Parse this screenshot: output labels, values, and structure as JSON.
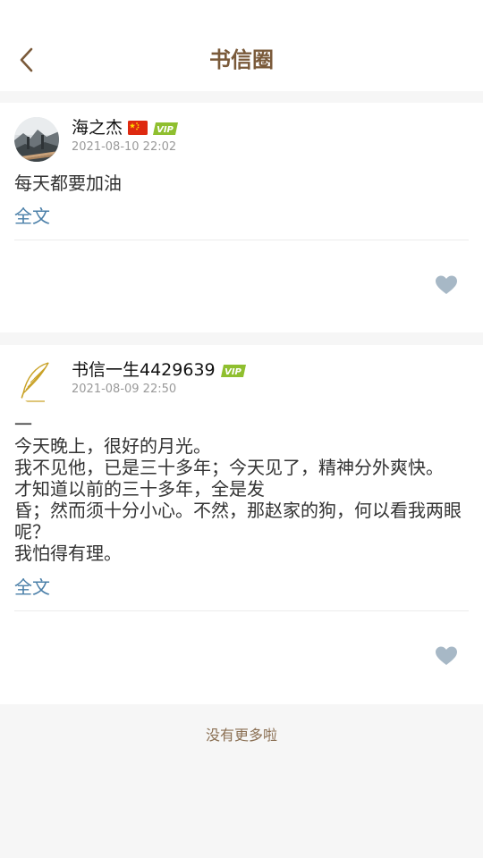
{
  "header": {
    "title": "书信圈",
    "back_icon": "chevron-left-icon"
  },
  "posts": [
    {
      "username": "海之杰",
      "has_flag": true,
      "flag_icon": "china-flag-icon",
      "vip_badge": "VIP",
      "time": "2021-08-10 22:02",
      "content": "每天都要加油",
      "fulltext_label": "全文",
      "like_icon": "heart-icon"
    },
    {
      "username": "书信一生4429639",
      "has_flag": false,
      "vip_badge": "VIP",
      "time": "2021-08-09 22:50",
      "content": "一\n今天晚上，很好的月光。\n我不见他，已是三十多年；今天见了，精神分外爽快。\n才知道以前的三十多年，全是发\n昏；然而须十分小心。不然，那赵家的狗，何以看我两眼呢？\n我怕得有理。",
      "fulltext_label": "全文",
      "like_icon": "heart-icon"
    }
  ],
  "footer": {
    "text": "没有更多啦"
  },
  "colors": {
    "title": "#7a5a3a",
    "link": "#4a7fa8",
    "vip": "#8fbf2f",
    "like": "#a7b8c6",
    "footer": "#8a6f53"
  }
}
